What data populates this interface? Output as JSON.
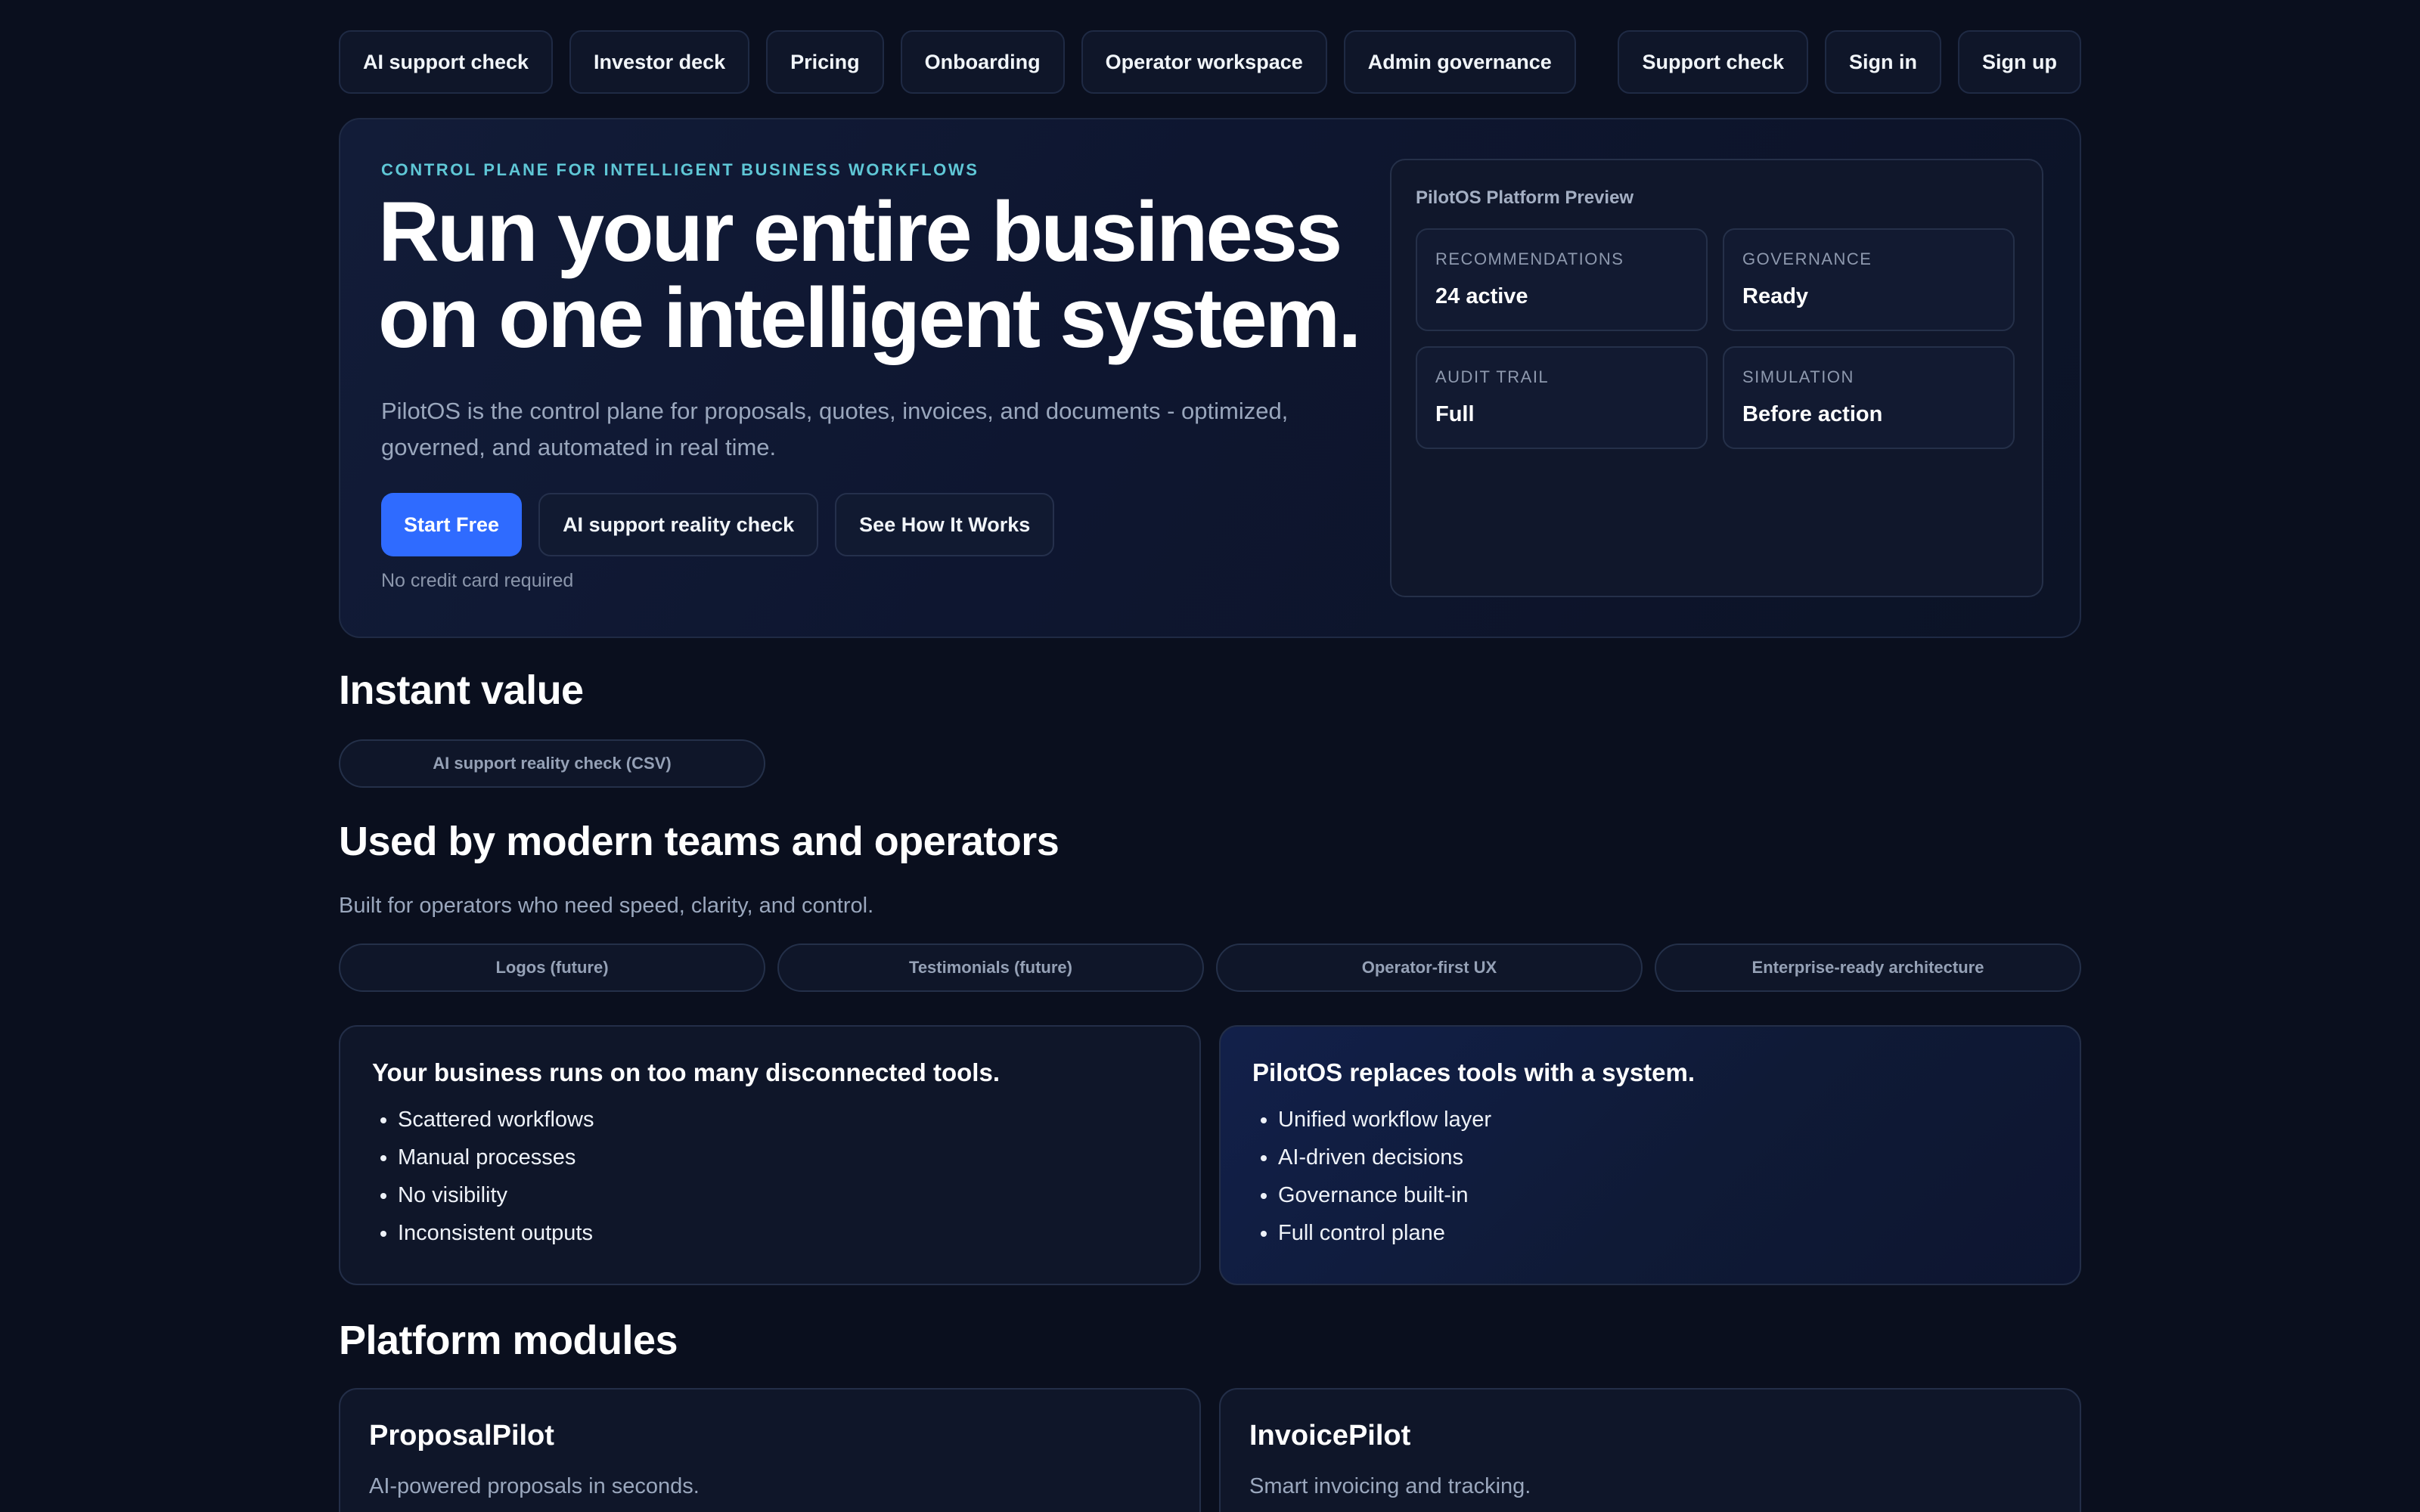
{
  "nav": {
    "left": [
      {
        "id": "ai-support-check",
        "label": "AI support check"
      },
      {
        "id": "investor-deck",
        "label": "Investor deck"
      },
      {
        "id": "pricing",
        "label": "Pricing"
      },
      {
        "id": "onboarding",
        "label": "Onboarding"
      },
      {
        "id": "operator-workspace",
        "label": "Operator workspace"
      },
      {
        "id": "admin-governance",
        "label": "Admin governance"
      }
    ],
    "right": [
      {
        "id": "support-check",
        "label": "Support check"
      },
      {
        "id": "sign-in",
        "label": "Sign in"
      },
      {
        "id": "sign-up",
        "label": "Sign up"
      }
    ]
  },
  "hero": {
    "eyebrow": "CONTROL PLANE FOR INTELLIGENT BUSINESS WORKFLOWS",
    "headline_line1": "Run your entire business",
    "headline_line2": "on one intelligent system.",
    "subtext": "PilotOS is the control plane for proposals, quotes, invoices, and documents - optimized, governed, and automated in real time.",
    "cta_primary": "Start Free",
    "cta_secondary": "AI support reality check",
    "cta_tertiary": "See How It Works",
    "note": "No credit card required",
    "preview": {
      "title": "PilotOS Platform Preview",
      "stats": [
        {
          "label": "RECOMMENDATIONS",
          "value": "24 active"
        },
        {
          "label": "GOVERNANCE",
          "value": "Ready"
        },
        {
          "label": "AUDIT TRAIL",
          "value": "Full"
        },
        {
          "label": "SIMULATION",
          "value": "Before action"
        }
      ]
    }
  },
  "instant_value": {
    "title": "Instant value",
    "chip": "AI support reality check (CSV)"
  },
  "social_proof": {
    "title": "Used by modern teams and operators",
    "lead": "Built for operators who need speed, clarity, and control.",
    "chips": [
      "Logos (future)",
      "Testimonials (future)",
      "Operator-first UX",
      "Enterprise-ready architecture"
    ]
  },
  "problem": {
    "title": "Your business runs on too many disconnected tools.",
    "items": [
      "Scattered workflows",
      "Manual processes",
      "No visibility",
      "Inconsistent outputs"
    ]
  },
  "solution": {
    "title": "PilotOS replaces tools with a system.",
    "items": [
      "Unified workflow layer",
      "AI-driven decisions",
      "Governance built-in",
      "Full control plane"
    ]
  },
  "modules": {
    "title": "Platform modules",
    "items": [
      {
        "name": "ProposalPilot",
        "desc": "AI-powered proposals in seconds."
      },
      {
        "name": "InvoicePilot",
        "desc": "Smart invoicing and tracking."
      }
    ]
  },
  "colors": {
    "background": "#0a0f1e",
    "accent": "#2f6bff",
    "eyebrow": "#5fc7d6"
  }
}
